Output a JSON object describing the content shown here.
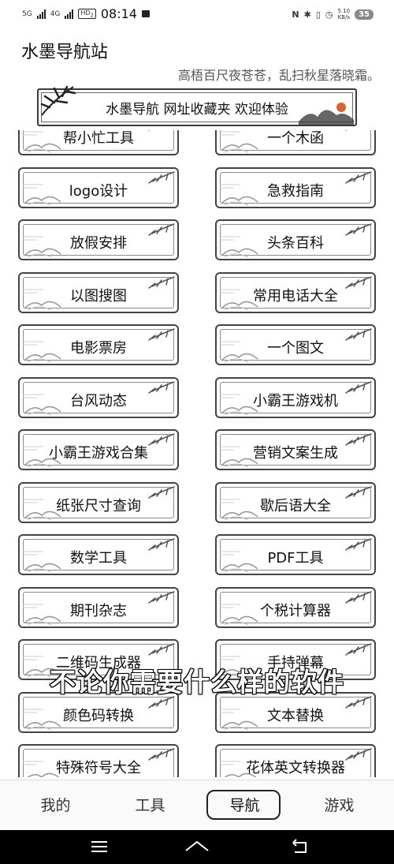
{
  "status_bar": {
    "net1": "5G",
    "net2": "4G",
    "hd": "HD",
    "hd_sub": "2",
    "time": "08:14",
    "icons_right": [
      "nfc-icon",
      "bluetooth-icon",
      "vibrate-icon",
      "alarm-icon"
    ],
    "speed_value": "5.10",
    "speed_unit": "KB/s",
    "battery": "35"
  },
  "header": {
    "title": "水墨导航站",
    "slogan": "高梧百尺夜苍苍，乱扫秋星落晓霜。"
  },
  "banner": {
    "text": "水墨导航 网址收藏夹 欢迎体验"
  },
  "tiles": [
    {
      "label": "帮小忙工具"
    },
    {
      "label": "一个木函"
    },
    {
      "label": "logo设计"
    },
    {
      "label": "急救指南"
    },
    {
      "label": "放假安排"
    },
    {
      "label": "头条百科"
    },
    {
      "label": "以图搜图"
    },
    {
      "label": "常用电话大全"
    },
    {
      "label": "电影票房"
    },
    {
      "label": "一个图文"
    },
    {
      "label": "台风动态"
    },
    {
      "label": "小霸王游戏机"
    },
    {
      "label": "小霸王游戏合集"
    },
    {
      "label": "营销文案生成"
    },
    {
      "label": "纸张尺寸查询"
    },
    {
      "label": "歇后语大全"
    },
    {
      "label": "数学工具"
    },
    {
      "label": "PDF工具"
    },
    {
      "label": "期刊杂志"
    },
    {
      "label": "个税计算器"
    },
    {
      "label": "二维码生成器"
    },
    {
      "label": "手持弹幕"
    },
    {
      "label": "颜色码转换"
    },
    {
      "label": "文本替换"
    },
    {
      "label": "特殊符号大全"
    },
    {
      "label": "花体英文转换器"
    }
  ],
  "subtitle": "不论你需要什么样的软件",
  "tabbar": {
    "tabs": [
      {
        "label": "我的"
      },
      {
        "label": "工具"
      },
      {
        "label": "导航",
        "active": true
      },
      {
        "label": "游戏"
      }
    ]
  },
  "system_nav": [
    "menu-icon",
    "home-icon",
    "back-icon"
  ]
}
